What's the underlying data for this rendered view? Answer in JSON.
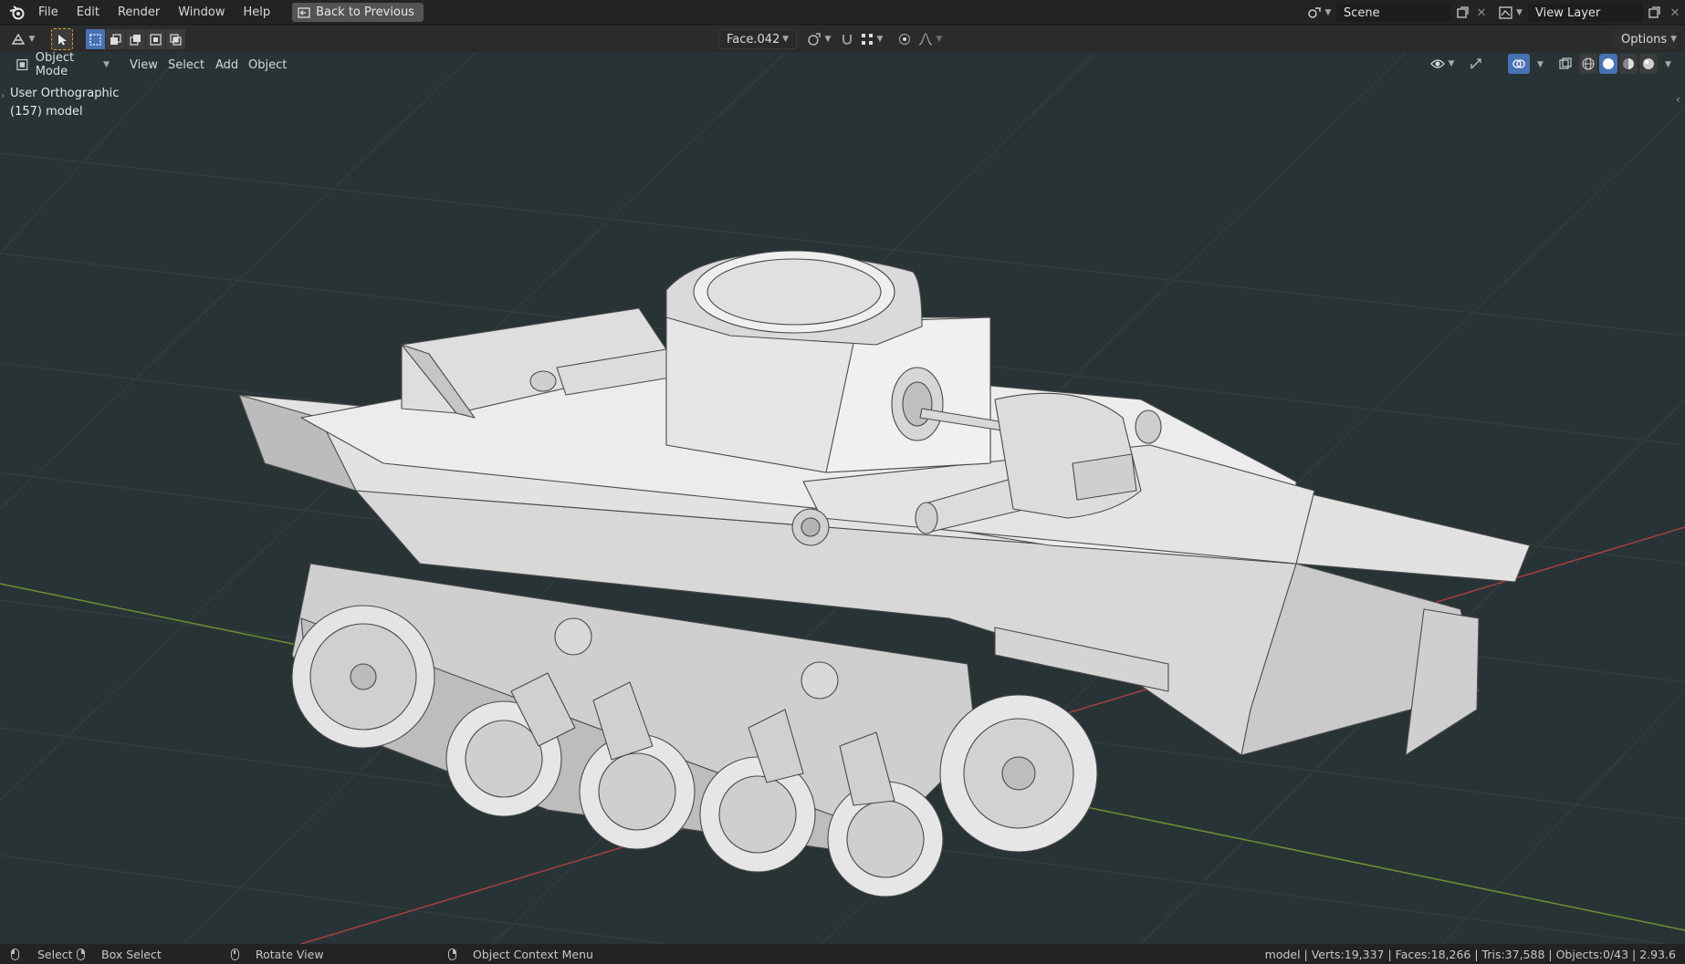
{
  "topbar": {
    "menu": [
      "File",
      "Edit",
      "Render",
      "Window",
      "Help"
    ],
    "back_button": "Back to Previous",
    "scene_value": "Scene",
    "view_layer_value": "View Layer"
  },
  "toolbar": {
    "face_selector": "Face.042",
    "options_label": "Options"
  },
  "header": {
    "mode_label": "Object Mode",
    "menu": [
      "View",
      "Select",
      "Add",
      "Object"
    ]
  },
  "viewport": {
    "view_name": "User Orthographic",
    "object_label": "(157) model"
  },
  "statusbar": {
    "select": "Select",
    "box_select": "Box Select",
    "rotate_view": "Rotate View",
    "context_menu": "Object Context Menu",
    "stats": "model | Verts:19,337 | Faces:18,266 | Tris:37,588 | Objects:0/43 | 2.93.6"
  },
  "colors": {
    "viewport_bg": "#283336",
    "accent": "#4772b3",
    "x_axis": "#b04444",
    "y_axis": "#7a9a3a"
  }
}
